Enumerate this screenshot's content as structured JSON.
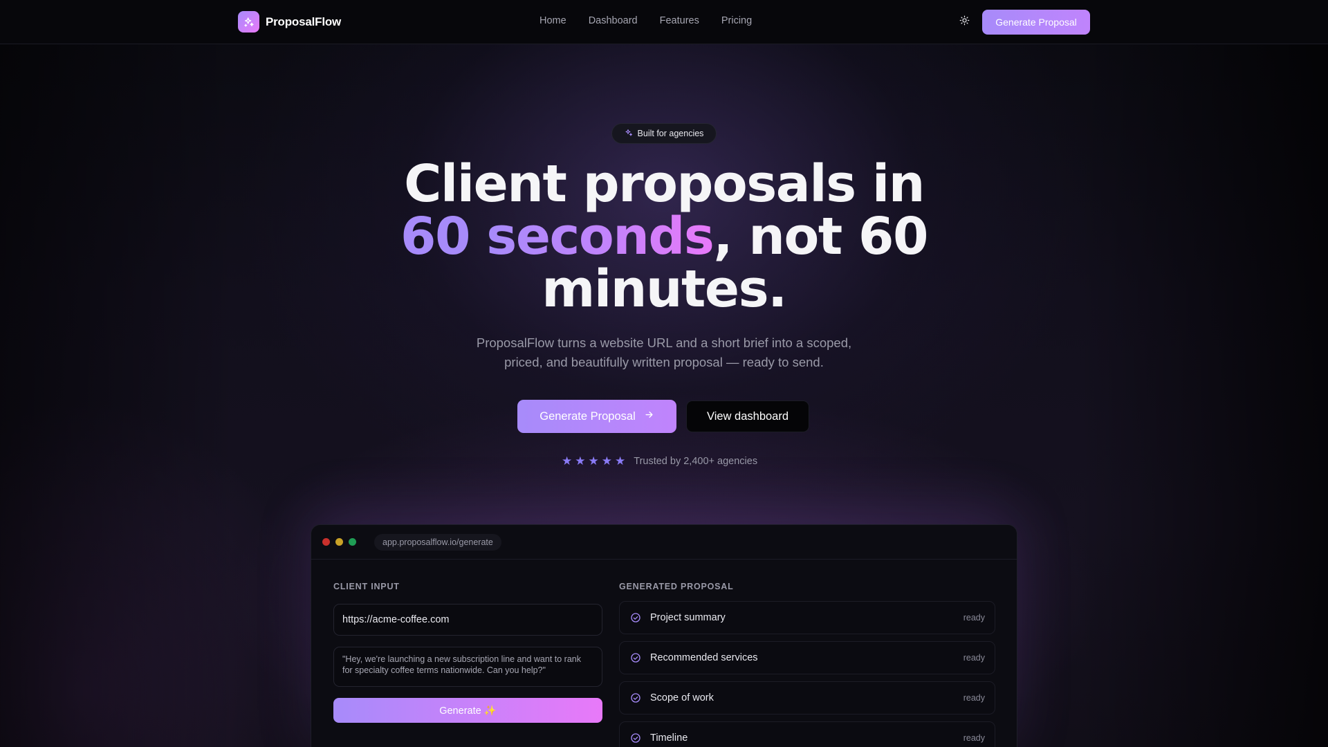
{
  "nav": {
    "brand": "ProposalFlow",
    "links": [
      "Home",
      "Dashboard",
      "Features",
      "Pricing"
    ],
    "cta": "Generate Proposal"
  },
  "hero": {
    "badge": "Built for agencies",
    "headline": {
      "part1": "Client proposals in ",
      "accent1": "60",
      "accent2": "seconds",
      "part2": ", not 60 minutes."
    },
    "subtitle": "ProposalFlow turns a website URL and a short brief into a scoped, priced, and beautifully written proposal — ready to send.",
    "primary_cta": "Generate Proposal",
    "secondary_cta": "View dashboard",
    "rating_stars": 5,
    "trust_text": "Trusted by 2,400+ agencies"
  },
  "preview": {
    "url": "app.proposalflow.io/generate",
    "client_input_label": "CLIENT INPUT",
    "url_value": "https://acme-coffee.com",
    "brief_value": "\"Hey, we're launching a new subscription line and want to rank for specialty coffee terms nationwide. Can you help?\"",
    "generate_label": "Generate ✨",
    "generated_label": "GENERATED PROPOSAL",
    "items": [
      {
        "title": "Project summary",
        "status": "ready"
      },
      {
        "title": "Recommended services",
        "status": "ready"
      },
      {
        "title": "Scope of work",
        "status": "ready"
      },
      {
        "title": "Timeline",
        "status": "ready"
      }
    ]
  },
  "colors": {
    "accent": "#a78bfa",
    "accent_pink": "#e879f9",
    "background": "#0a0a10",
    "star": "#8b7cf6"
  },
  "icons": {
    "brand": "sparkles-icon",
    "theme": "sun-icon",
    "badge": "sparkles-icon",
    "cta_arrow": "arrow-right-icon",
    "item_status": "check-circle-icon"
  }
}
